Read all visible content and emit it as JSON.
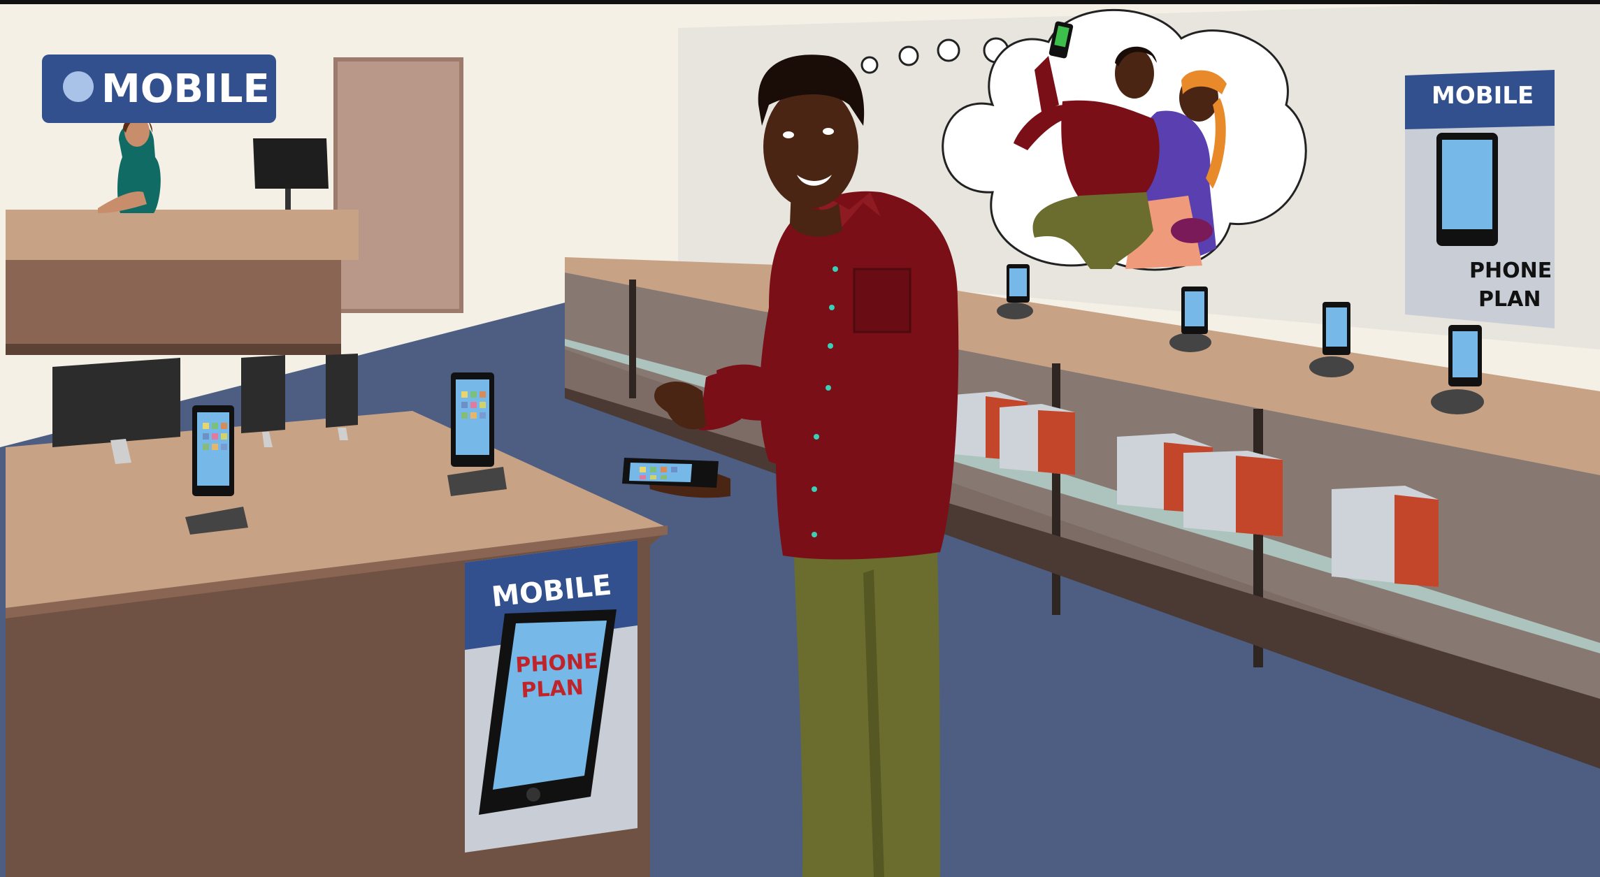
{
  "signs": {
    "top_left": "MOBILE",
    "right_wall_top": "MOBILE",
    "right_wall_bottom_line1": "PHONE",
    "right_wall_bottom_line2": "PLAN",
    "counter_top": "MOBILE",
    "counter_phone_line1": "PHONE",
    "counter_phone_line2": "PLAN"
  },
  "colors": {
    "wall_left": "#f4f0e6",
    "wall_right": "#e8e5df",
    "floor": "#4d5e82",
    "counter_top": "#c8a285",
    "counter_side": "#6f5244",
    "sign_blue": "#33508e",
    "shirt": "#7a0f17",
    "pants": "#6b6d2e",
    "skin": "#4a2514",
    "screen": "#76b8e8",
    "box_white": "#cdd3d8",
    "box_orange": "#c4462a"
  }
}
